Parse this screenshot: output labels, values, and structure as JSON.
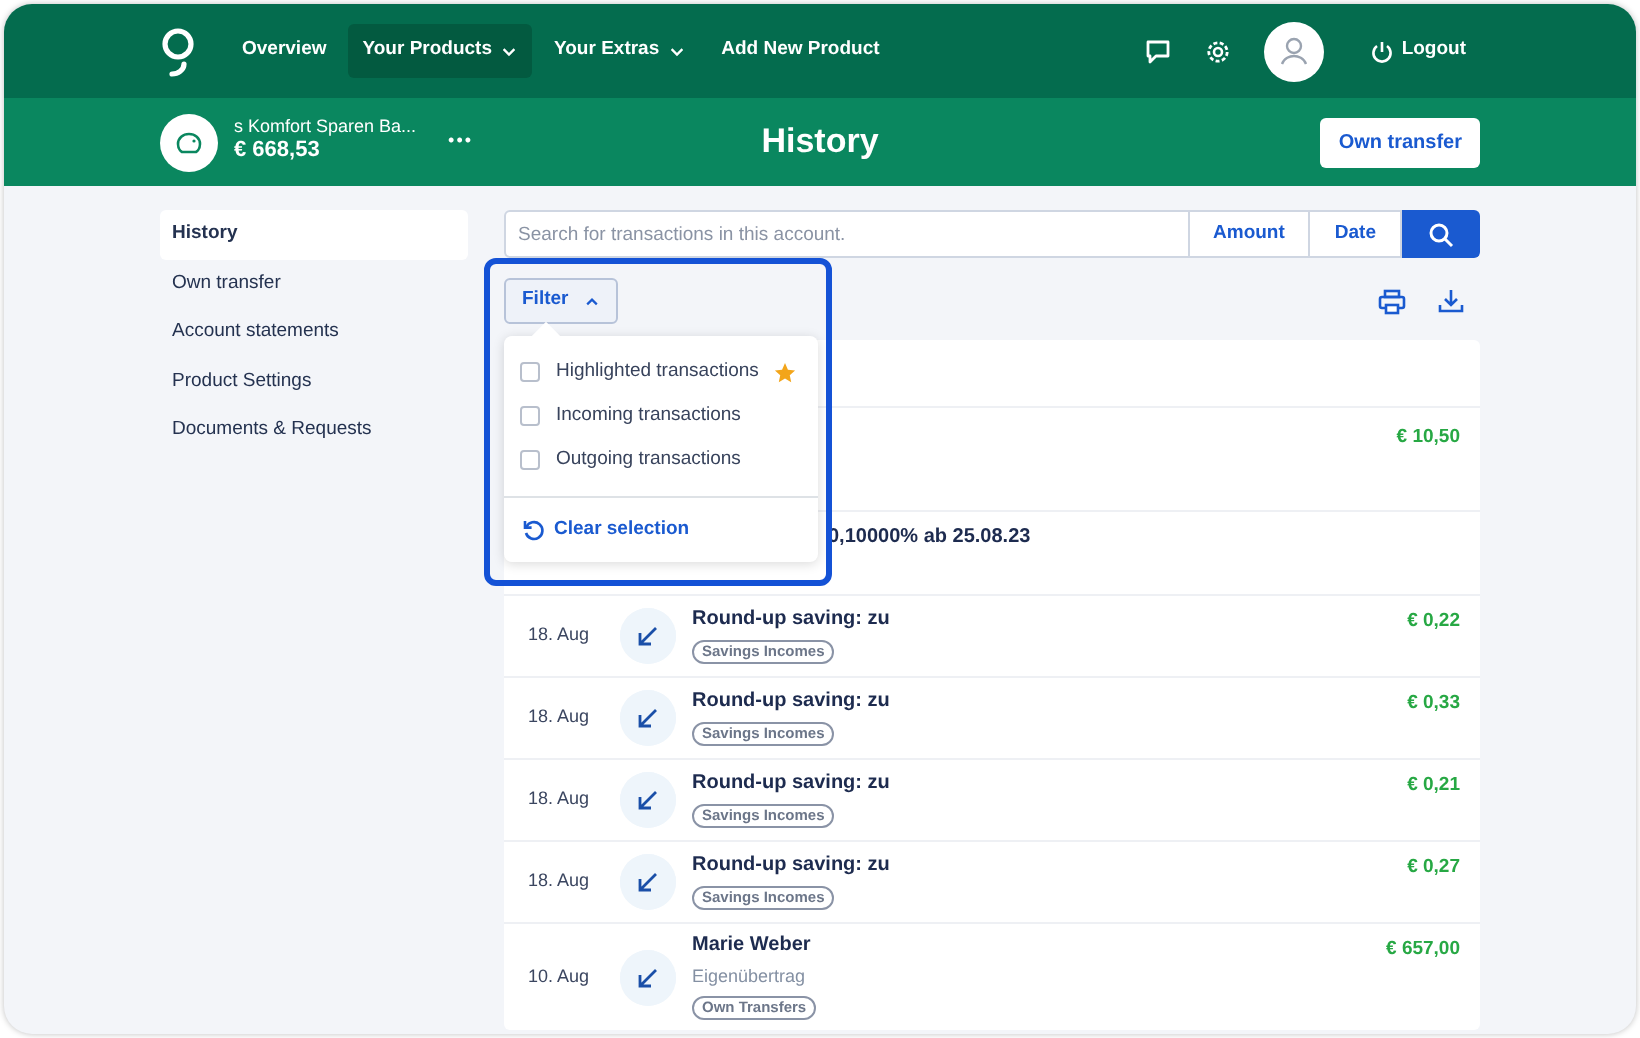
{
  "nav": {
    "items": [
      {
        "label": "Overview",
        "selected": false,
        "dropdown": false
      },
      {
        "label": "Your Products",
        "selected": true,
        "dropdown": true
      },
      {
        "label": "Your Extras",
        "selected": false,
        "dropdown": true
      },
      {
        "label": "Add New Product",
        "selected": false,
        "dropdown": false
      }
    ],
    "logout": "Logout"
  },
  "account": {
    "name": "s Komfort Sparen Ba...",
    "balance": "€ 668,53",
    "more": "•••"
  },
  "page_title": "History",
  "own_transfer_button": "Own transfer",
  "sidebar": {
    "items": [
      {
        "label": "History",
        "selected": true
      },
      {
        "label": "Own transfer",
        "selected": false
      },
      {
        "label": "Account statements",
        "selected": false
      },
      {
        "label": "Product Settings",
        "selected": false
      },
      {
        "label": "Documents & Requests",
        "selected": false
      }
    ]
  },
  "search": {
    "placeholder": "Search for transactions in this account.",
    "buttons": [
      "Amount",
      "Date"
    ]
  },
  "filter": {
    "label": "Filter",
    "expanded": true,
    "highlighted": true,
    "options": [
      {
        "label": "Highlighted transactions",
        "checked": false,
        "starred": true
      },
      {
        "label": "Incoming transactions",
        "checked": false,
        "starred": false
      },
      {
        "label": "Outgoing transactions",
        "checked": false,
        "starred": false
      }
    ],
    "clear": "Clear selection"
  },
  "transactions": [
    {
      "kind": "covered",
      "amount": "€ 10,50"
    },
    {
      "kind": "covered",
      "title": "0,10000% ab 25.08.23"
    },
    {
      "kind": "full",
      "date": "18. Aug",
      "title": "Round-up saving: zu",
      "tag": "Savings Incomes",
      "amount": "€ 0,22"
    },
    {
      "kind": "full",
      "date": "18. Aug",
      "title": "Round-up saving: zu",
      "tag": "Savings Incomes",
      "amount": "€ 0,33"
    },
    {
      "kind": "full",
      "date": "18. Aug",
      "title": "Round-up saving: zu",
      "tag": "Savings Incomes",
      "amount": "€ 0,21"
    },
    {
      "kind": "full",
      "date": "18. Aug",
      "title": "Round-up saving: zu",
      "tag": "Savings Incomes",
      "amount": "€ 0,27"
    },
    {
      "kind": "full",
      "date": "10. Aug",
      "title": "Marie Weber",
      "subtitle": "Eigenübertrag",
      "tag": "Own Transfers",
      "amount": "€ 657,00"
    }
  ]
}
